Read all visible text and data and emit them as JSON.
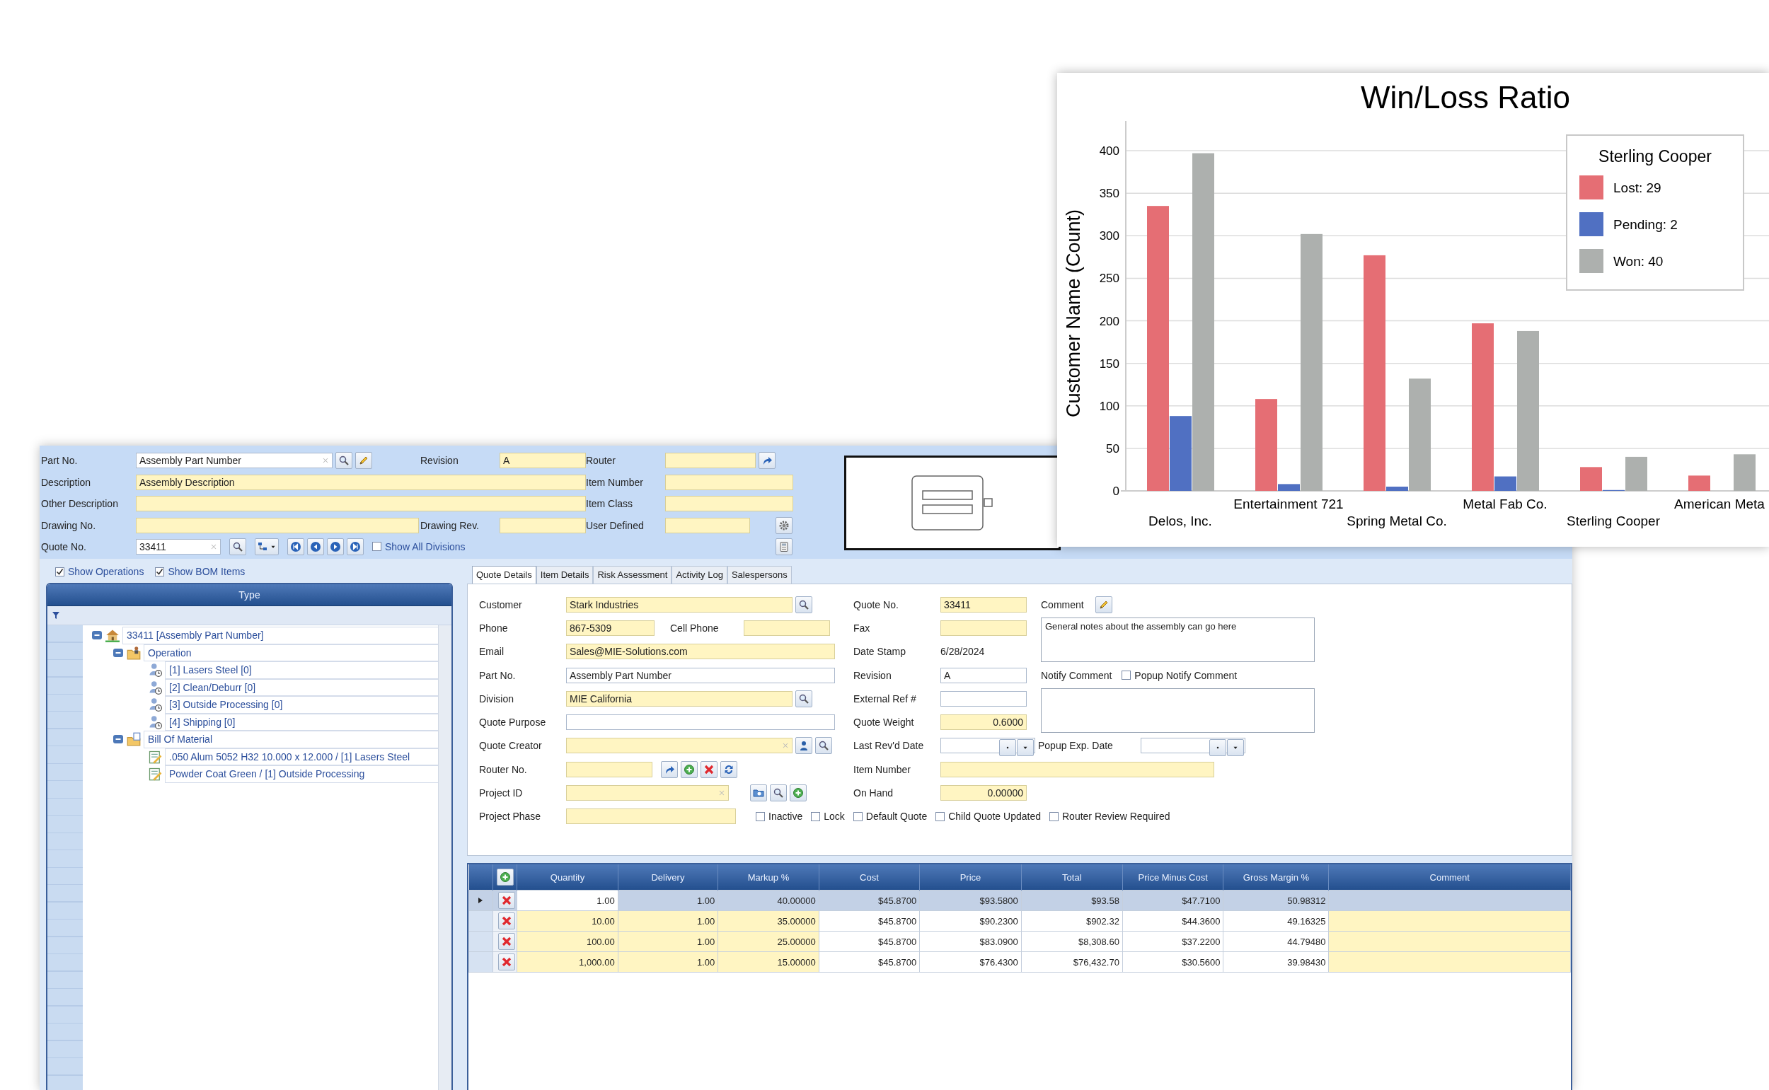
{
  "header": {
    "part_no": {
      "label": "Part No.",
      "value": "Assembly Part Number",
      "highlighted": false
    },
    "revision": {
      "label": "Revision",
      "value": "A",
      "highlighted": true
    },
    "router": {
      "label": "Router",
      "highlighted": true
    },
    "description": {
      "label": "Description",
      "value": "Assembly Description",
      "highlighted": true
    },
    "item_number": {
      "label": "Item Number",
      "highlighted": true
    },
    "other_description": {
      "label": "Other Description",
      "highlighted": true
    },
    "item_class": {
      "label": "Item Class",
      "highlighted": true
    },
    "drawing_no": {
      "label": "Drawing No.",
      "highlighted": true
    },
    "drawing_rev": {
      "label": "Drawing Rev.",
      "highlighted": true
    },
    "user_defined": {
      "label": "User Defined",
      "highlighted": true
    },
    "quote_no": {
      "label": "Quote No.",
      "value": "33411",
      "highlighted": false
    },
    "show_all_divisions": {
      "label": "Show All Divisions",
      "checked": false
    }
  },
  "tree_panel": {
    "show_operations": {
      "label": "Show Operations",
      "checked": true
    },
    "show_bom_items": {
      "label": "Show BOM Items",
      "checked": true
    },
    "column": "Type",
    "nodes": [
      {
        "kind": "root",
        "label": "33411 [Assembly Part Number]",
        "expanded": true,
        "children": [
          {
            "kind": "operations",
            "label": "Operation",
            "expanded": true,
            "children": [
              {
                "kind": "operation",
                "label": "[1] Lasers Steel [0]"
              },
              {
                "kind": "operation",
                "label": "[2] Clean/Deburr [0]"
              },
              {
                "kind": "operation",
                "label": "[3] Outside Processing [0]"
              },
              {
                "kind": "operation",
                "label": "[4] Shipping [0]"
              }
            ]
          },
          {
            "kind": "materials",
            "label": "Bill Of Material",
            "expanded": true,
            "children": [
              {
                "kind": "material",
                "label": ".050 Alum 5052 H32 10.000 x 12.000 / [1] Lasers Steel"
              },
              {
                "kind": "material",
                "label": "Powder Coat Green / [1] Outside Processing"
              }
            ]
          }
        ]
      }
    ]
  },
  "tabs": [
    {
      "label": "Quote Details",
      "selected": true
    },
    {
      "label": "Item Details",
      "selected": false
    },
    {
      "label": "Risk Assessment",
      "selected": false
    },
    {
      "label": "Activity Log",
      "selected": false
    },
    {
      "label": "Salespersons",
      "selected": false
    }
  ],
  "quote_details": {
    "customer": {
      "label": "Customer",
      "value": "Stark Industries",
      "highlighted": true
    },
    "phone": {
      "label": "Phone",
      "value": "867-5309",
      "highlighted": true
    },
    "cell_phone": {
      "label": "Cell Phone",
      "highlighted": true
    },
    "email": {
      "label": "Email",
      "value": "Sales@MIE-Solutions.com",
      "highlighted": true
    },
    "part_no": {
      "label": "Part No.",
      "value": "Assembly Part Number",
      "highlighted": false
    },
    "division": {
      "label": "Division",
      "value": "MIE California",
      "highlighted": true
    },
    "quote_purpose": {
      "label": "Quote Purpose",
      "highlighted": false
    },
    "quote_creator": {
      "label": "Quote Creator",
      "highlighted": true
    },
    "router_no": {
      "label": "Router No.",
      "highlighted": true
    },
    "project_id": {
      "label": "Project ID",
      "highlighted": true
    },
    "project_phase": {
      "label": "Project Phase",
      "highlighted": true
    },
    "quote_no": {
      "label": "Quote No.",
      "value": "33411",
      "highlighted": true
    },
    "fax": {
      "label": "Fax",
      "highlighted": true
    },
    "date_stamp": {
      "label": "Date Stamp",
      "value": "6/28/2024"
    },
    "revision": {
      "label": "Revision",
      "value": "A",
      "highlighted": false
    },
    "external_ref": {
      "label": "External Ref #",
      "highlighted": false
    },
    "quote_weight": {
      "label": "Quote Weight",
      "value": "0.6000",
      "highlighted": true
    },
    "last_revd_date": {
      "label": "Last Rev'd Date",
      "highlighted": false
    },
    "popup_exp_date": {
      "label": "Popup Exp. Date",
      "highlighted": false
    },
    "item_number": {
      "label": "Item Number",
      "highlighted": true
    },
    "on_hand": {
      "label": "On Hand",
      "value": "0.00000",
      "highlighted": true
    },
    "comment": {
      "label": "Comment",
      "value": "General notes about the assembly can go here"
    },
    "notify_comment": {
      "label": "Notify Comment"
    },
    "popup_notify_comment": {
      "label": "Popup Notify Comment",
      "checked": false
    },
    "flags": [
      {
        "label": "Inactive",
        "checked": false
      },
      {
        "label": "Lock",
        "checked": false
      },
      {
        "label": "Default Quote",
        "checked": false
      },
      {
        "label": "Child Quote Updated",
        "checked": false
      },
      {
        "label": "Router Review Required",
        "checked": false
      }
    ]
  },
  "pricing_grid": {
    "columns": [
      {
        "label": "Quantity",
        "editable": true
      },
      {
        "label": "Delivery",
        "editable": true
      },
      {
        "label": "Markup %",
        "editable": true
      },
      {
        "label": "Cost",
        "editable": false
      },
      {
        "label": "Price",
        "editable": false
      },
      {
        "label": "Total",
        "editable": false
      },
      {
        "label": "Price Minus Cost",
        "editable": false
      },
      {
        "label": "Gross Margin %",
        "editable": false
      },
      {
        "label": "Comment",
        "editable": true
      }
    ],
    "rows": [
      {
        "selected": true,
        "cells": [
          "1.00",
          "1.00",
          "40.00000",
          "$45.8700",
          "$93.5800",
          "$93.58",
          "$47.7100",
          "50.98312",
          ""
        ]
      },
      {
        "selected": false,
        "cells": [
          "10.00",
          "1.00",
          "35.00000",
          "$45.8700",
          "$90.2300",
          "$902.32",
          "$44.3600",
          "49.16325",
          ""
        ]
      },
      {
        "selected": false,
        "cells": [
          "100.00",
          "1.00",
          "25.00000",
          "$45.8700",
          "$83.0900",
          "$8,308.60",
          "$37.2200",
          "44.79480",
          ""
        ]
      },
      {
        "selected": false,
        "cells": [
          "1,000.00",
          "1.00",
          "15.00000",
          "$45.8700",
          "$76.4300",
          "$76,432.70",
          "$30.5600",
          "39.98430",
          ""
        ]
      }
    ]
  },
  "chart": {
    "chart_data": {
      "type": "bar",
      "title": "Win/Loss Ratio",
      "ylabel": "Customer Name (Count)",
      "grid": true,
      "legend": {
        "title": "Sterling Cooper"
      },
      "categories": [
        "Delos, Inc.",
        "Entertainment 721",
        "Spring Metal Co.",
        "Metal Fab Co.",
        "Sterling Cooper",
        "American Meta"
      ],
      "series": [
        {
          "name": "Lost: 29",
          "color": "#e56e74",
          "values": [
            335,
            108,
            277,
            197,
            28,
            18
          ]
        },
        {
          "name": "Pending: 2",
          "color": "#5070c2",
          "values": [
            88,
            8,
            5,
            17,
            1,
            null
          ]
        },
        {
          "name": "Won: 40",
          "color": "#adb0ae",
          "values": [
            397,
            302,
            132,
            188,
            40,
            43
          ]
        }
      ],
      "ylim": [
        0,
        400
      ],
      "yticks": [
        0,
        50,
        100,
        150,
        200,
        250,
        300,
        350,
        400
      ]
    }
  }
}
